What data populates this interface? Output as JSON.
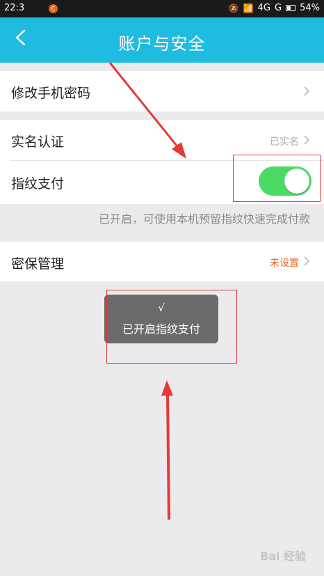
{
  "status_bar": {
    "time": "22:3",
    "app_icon": "C",
    "network1": "4G",
    "network2": "G",
    "battery": "54%"
  },
  "header": {
    "title": "账户与安全"
  },
  "rows": {
    "change_password": {
      "label": "修改手机密码"
    },
    "realname": {
      "label": "实名认证",
      "value": "已实名"
    },
    "fingerprint": {
      "label": "指纹支付",
      "enabled": true
    },
    "fingerprint_hint": "已开启，可使用本机预留指纹快速完成付款",
    "security_question": {
      "label": "密保管理",
      "value": "未设置"
    }
  },
  "toast": {
    "check": "√",
    "message": "已开启指纹支付"
  },
  "watermark": "Bai 经验",
  "colors": {
    "header": "#1fbce0",
    "toggle_on": "#4cd964",
    "warn": "#ec6a2c",
    "annotation": "#e53935"
  }
}
